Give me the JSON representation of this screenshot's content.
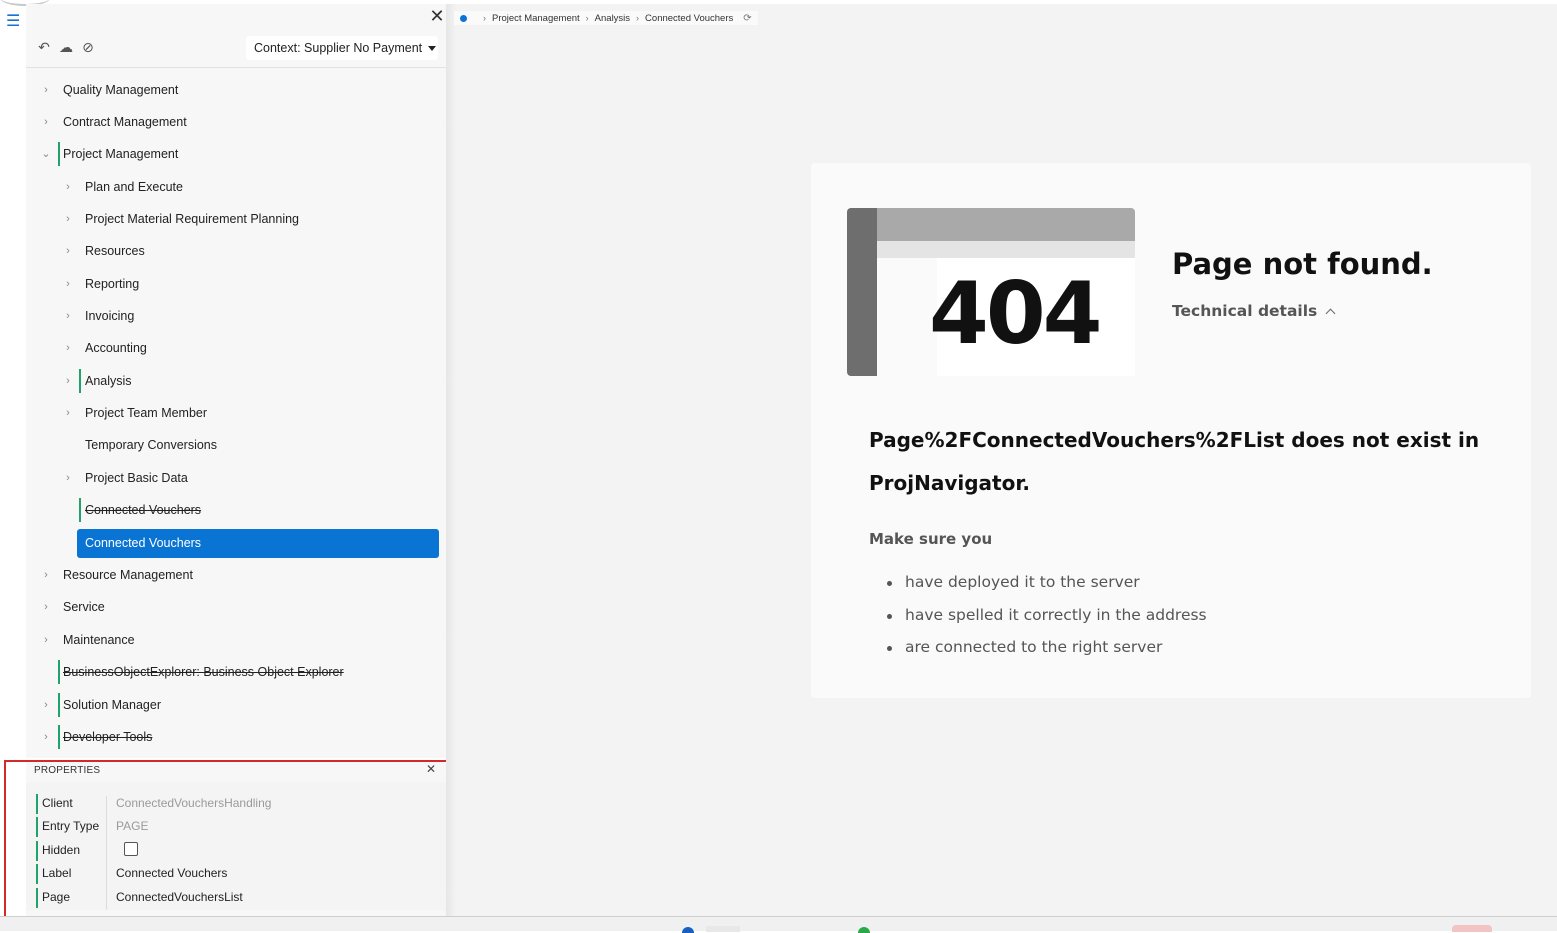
{
  "navigator": {
    "context_label": "Context: Supplier No Payment",
    "items": [
      {
        "label": "Quality Management"
      },
      {
        "label": "Contract Management"
      },
      {
        "label": "Project Management"
      },
      {
        "label": "Plan and Execute"
      },
      {
        "label": "Project Material Requirement Planning"
      },
      {
        "label": "Resources"
      },
      {
        "label": "Reporting"
      },
      {
        "label": "Invoicing"
      },
      {
        "label": "Accounting"
      },
      {
        "label": "Analysis"
      },
      {
        "label": "Project Team Member"
      },
      {
        "label": "Temporary Conversions"
      },
      {
        "label": "Project Basic Data"
      },
      {
        "label": "Connected Vouchers"
      },
      {
        "label": "Connected Vouchers"
      },
      {
        "label": "Resource Management"
      },
      {
        "label": "Service"
      },
      {
        "label": "Maintenance"
      },
      {
        "label": "BusinessObjectExplorer: Business Object Explorer"
      },
      {
        "label": "Solution Manager"
      },
      {
        "label": "Developer Tools"
      }
    ]
  },
  "properties": {
    "title": "PROPERTIES",
    "rows": [
      {
        "key": "Client",
        "value": "ConnectedVouchersHandling"
      },
      {
        "key": "Entry Type",
        "value": "PAGE"
      },
      {
        "key": "Hidden",
        "value": ""
      },
      {
        "key": "Label",
        "value": "Connected Vouchers"
      },
      {
        "key": "Page",
        "value": "ConnectedVouchersList"
      }
    ]
  },
  "breadcrumb": {
    "items": [
      "Project Management",
      "Analysis",
      "Connected Vouchers"
    ]
  },
  "error": {
    "code": "404",
    "title": "Page not found.",
    "details_label": "Technical details",
    "message": "Page%2FConnectedVouchers%2FList does not exist in ProjNavigator.",
    "make_sure": "Make sure you",
    "tips": [
      "have deployed it to the server",
      "have spelled it correctly in the address",
      "are connected to the right server"
    ]
  },
  "colors": {
    "accent": "#0a74d4",
    "marker": "#1fa36b",
    "highlight": "#d12a2a"
  }
}
